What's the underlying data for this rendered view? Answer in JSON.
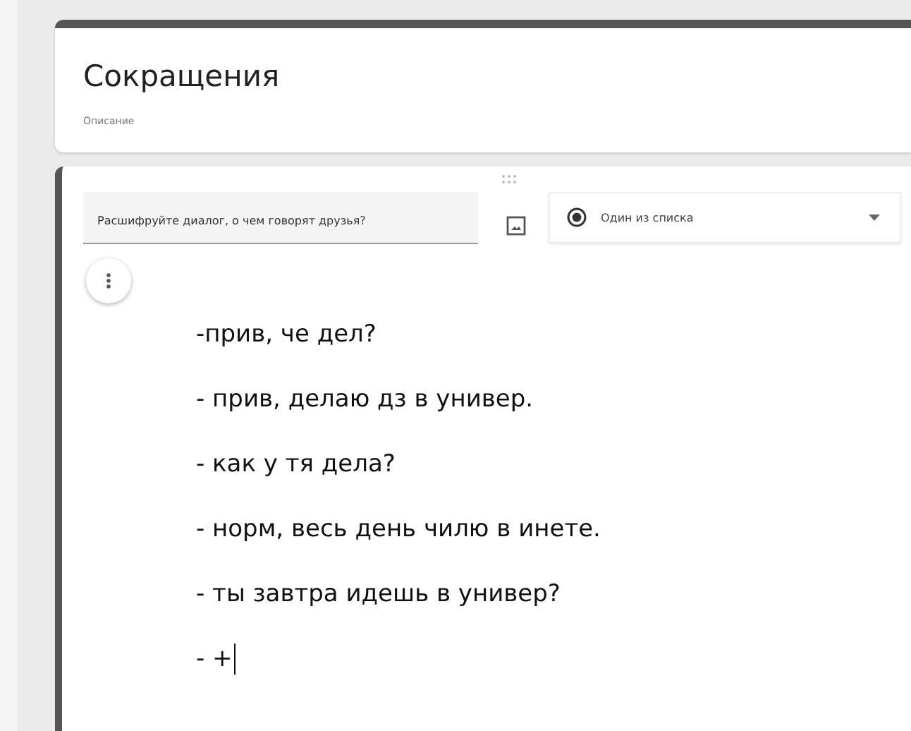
{
  "form": {
    "title": "Сокращения",
    "description": "Описание"
  },
  "question": {
    "title": "Расшифруйте диалог,  о чем говорят друзья?",
    "type_dropdown": {
      "label": "Один из списка"
    },
    "dialog_lines": [
      "-прив, че дел?",
      "- прив, делаю дз в универ.",
      "- как у тя дела?",
      "- норм, весь день чилю в инете.",
      "- ты завтра идешь в универ?",
      "- +"
    ],
    "text_cursor": true
  }
}
